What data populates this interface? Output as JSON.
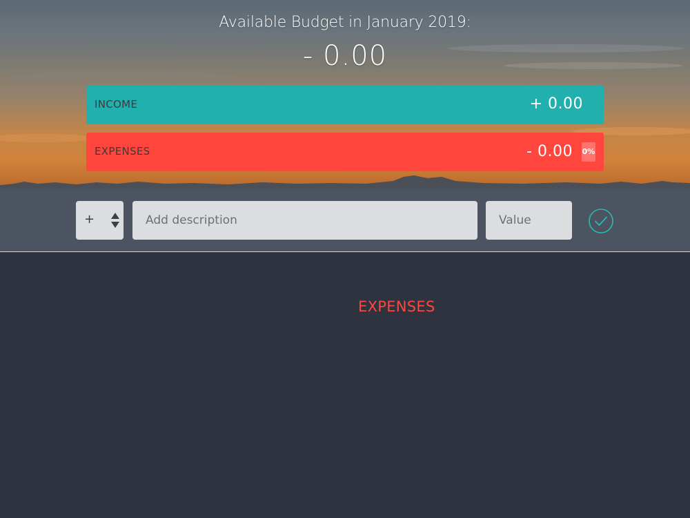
{
  "header": {
    "title": "Available Budget in January 2019:",
    "budget": "- 0.00"
  },
  "income": {
    "label": "INCOME",
    "value": "+ 0.00"
  },
  "expenses": {
    "label": "EXPENSES",
    "value": "- 0.00",
    "percentage": "0%"
  },
  "add_bar": {
    "type_selected": "+",
    "description_placeholder": "Add description",
    "value_placeholder": "Value",
    "submit_icon": "check-circle-icon"
  },
  "lists": {
    "expenses_title": "EXPENSES"
  },
  "colors": {
    "income": "#22b0ae",
    "expenses": "#ff463e",
    "bar_bg": "#4c5361",
    "page_bg": "#2f333f",
    "accent_check": "#28b9b5"
  }
}
